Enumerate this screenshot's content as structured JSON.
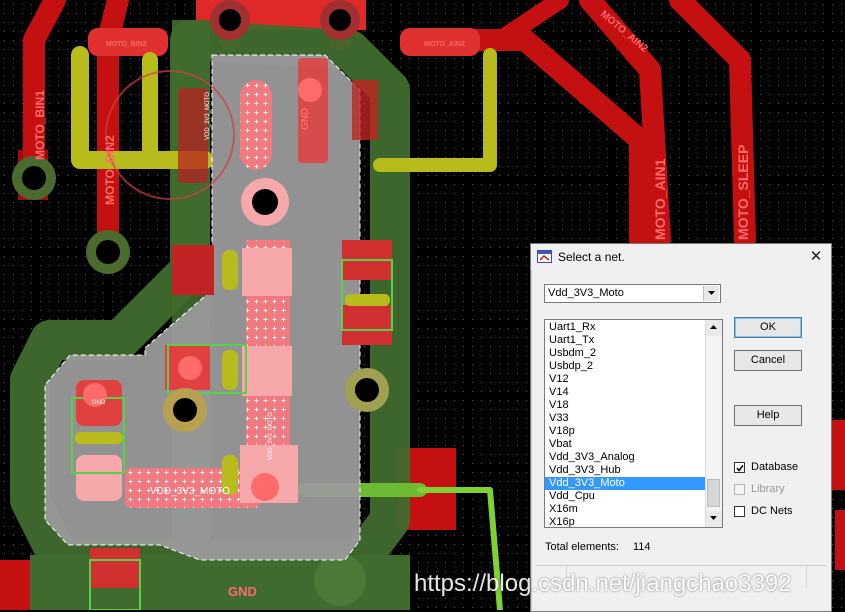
{
  "pcb": {
    "labels": {
      "moto_bin1_pad": "MOTO_BIN2",
      "moto_ain1_pad": "MOTO_AIN2",
      "moto_bin1": "MOTO_BIN1",
      "moto_bin2": "MOTO_BIN2",
      "moto_ain1": "MOTO_AIN1",
      "moto_sleep": "MOTO_SLEEP",
      "moto_ain2": "MOTO_AIN2",
      "gnd_top": "GND",
      "gnd_bottom": "GND",
      "vdd_net": "VDD_3V3_MOTO",
      "vdd_v1": "VDD_3V3_MOTO",
      "vdd_v2": "VDD_3V3_MOTO",
      "pad_small": "GND"
    },
    "colors": {
      "background": "#000000",
      "red_trace": "#c41010",
      "green_area": "#3f6b2e",
      "yellow_trace": "#b8bb1c",
      "gray_polygon": "#9a9a9a",
      "selected_net": "#f07a80"
    }
  },
  "dialog": {
    "title": "Select a net.",
    "close_symbol": "✕",
    "selected_value": "Vdd_3V3_Moto",
    "net_list": [
      "Uart1_Rx",
      "Uart1_Tx",
      "Usbdm_2",
      "Usbdp_2",
      "V12",
      "V14",
      "V18",
      "V33",
      "V18p",
      "Vbat",
      "Vdd_3V3_Analog",
      "Vdd_3V3_Hub",
      "Vdd_3V3_Moto",
      "Vdd_Cpu",
      "X16m",
      "X16p"
    ],
    "selected_index": 12,
    "buttons": {
      "ok": "OK",
      "cancel": "Cancel",
      "help": "Help"
    },
    "checkboxes": {
      "database": {
        "label": "Database",
        "checked": true,
        "enabled": true
      },
      "library": {
        "label": "Library",
        "checked": false,
        "enabled": false
      },
      "dc_nets": {
        "label": "DC Nets",
        "checked": false,
        "enabled": true
      }
    },
    "total_label": "Total elements:",
    "total_count": "114"
  },
  "watermark": "https://blog.csdn.net/jiangchao3392"
}
